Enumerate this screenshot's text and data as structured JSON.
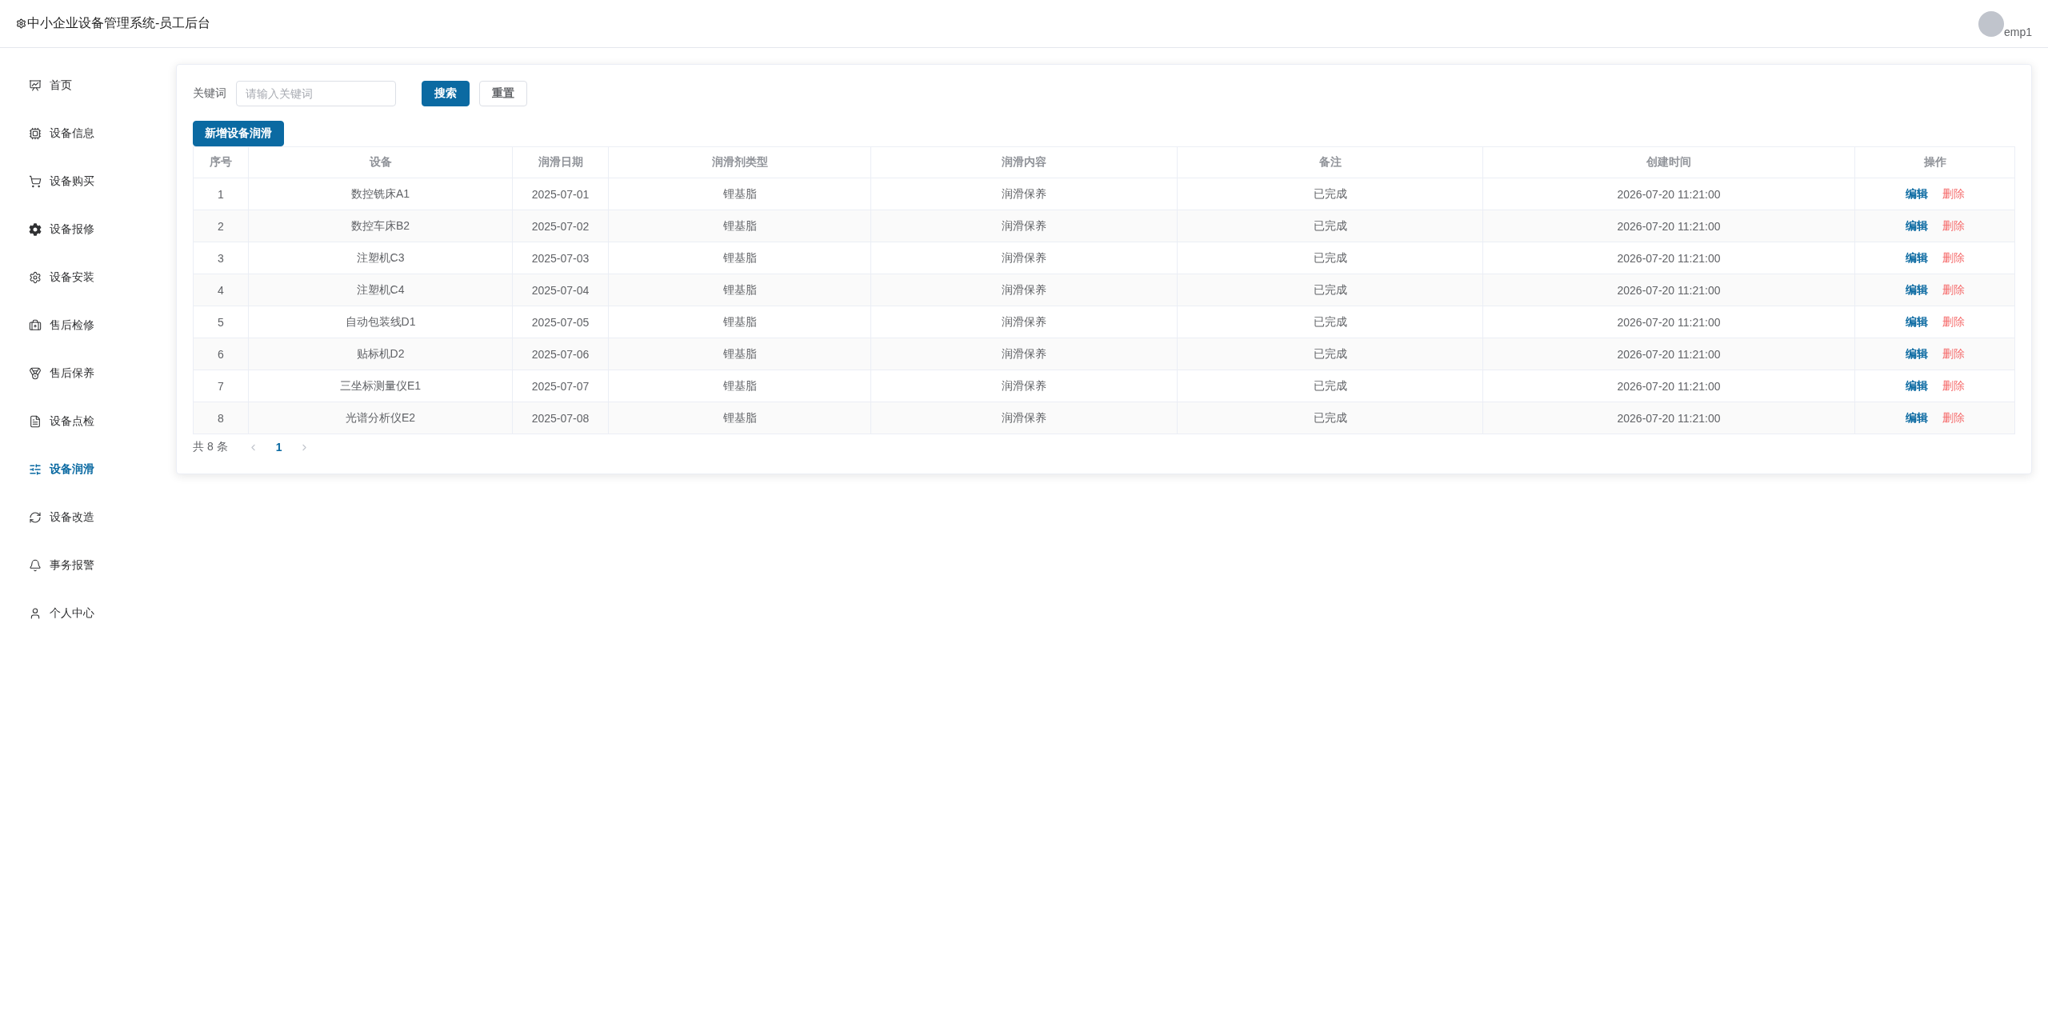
{
  "header": {
    "title": "中小企业设备管理系统-员工后台",
    "user": "emp1"
  },
  "sidebar": {
    "items": [
      {
        "label": "首页",
        "selected": false
      },
      {
        "label": "设备信息",
        "selected": false
      },
      {
        "label": "设备购买",
        "selected": false
      },
      {
        "label": "设备报修",
        "selected": false
      },
      {
        "label": "设备安装",
        "selected": false
      },
      {
        "label": "售后检修",
        "selected": false
      },
      {
        "label": "售后保养",
        "selected": false
      },
      {
        "label": "设备点检",
        "selected": false
      },
      {
        "label": "设备润滑",
        "selected": true
      },
      {
        "label": "设备改造",
        "selected": false
      },
      {
        "label": "事务报警",
        "selected": false
      },
      {
        "label": "个人中心",
        "selected": false
      }
    ]
  },
  "search": {
    "label": "关键词",
    "placeholder": "请输入关键词",
    "buttons": [
      {
        "label": "搜索",
        "kind": "primary"
      },
      {
        "label": "重置",
        "kind": "default"
      }
    ]
  },
  "add_button": "新增设备润滑",
  "table": {
    "columns": [
      "序号",
      "设备",
      "润滑日期",
      "润滑剂类型",
      "润滑内容",
      "备注",
      "创建时间",
      "操作"
    ],
    "rows": [
      {
        "cells": [
          "1",
          "数控铣床A1",
          "2025-07-01",
          "锂基脂",
          "润滑保养",
          "已完成",
          "2026-07-20 11:21:00"
        ],
        "actions": [
          {
            "label": "编辑",
            "kind": "edit"
          },
          {
            "label": "删除",
            "kind": "delete"
          }
        ]
      },
      {
        "cells": [
          "2",
          "数控车床B2",
          "2025-07-02",
          "锂基脂",
          "润滑保养",
          "已完成",
          "2026-07-20 11:21:00"
        ],
        "actions": [
          {
            "label": "编辑",
            "kind": "edit"
          },
          {
            "label": "删除",
            "kind": "delete"
          }
        ]
      },
      {
        "cells": [
          "3",
          "注塑机C3",
          "2025-07-03",
          "锂基脂",
          "润滑保养",
          "已完成",
          "2026-07-20 11:21:00"
        ],
        "actions": [
          {
            "label": "编辑",
            "kind": "edit"
          },
          {
            "label": "删除",
            "kind": "delete"
          }
        ]
      },
      {
        "cells": [
          "4",
          "注塑机C4",
          "2025-07-04",
          "锂基脂",
          "润滑保养",
          "已完成",
          "2026-07-20 11:21:00"
        ],
        "actions": [
          {
            "label": "编辑",
            "kind": "edit"
          },
          {
            "label": "删除",
            "kind": "delete"
          }
        ]
      },
      {
        "cells": [
          "5",
          "自动包装线D1",
          "2025-07-05",
          "锂基脂",
          "润滑保养",
          "已完成",
          "2026-07-20 11:21:00"
        ],
        "actions": [
          {
            "label": "编辑",
            "kind": "edit"
          },
          {
            "label": "删除",
            "kind": "delete"
          }
        ]
      },
      {
        "cells": [
          "6",
          "贴标机D2",
          "2025-07-06",
          "锂基脂",
          "润滑保养",
          "已完成",
          "2026-07-20 11:21:00"
        ],
        "actions": [
          {
            "label": "编辑",
            "kind": "edit"
          },
          {
            "label": "删除",
            "kind": "delete"
          }
        ]
      },
      {
        "cells": [
          "7",
          "三坐标测量仪E1",
          "2025-07-07",
          "锂基脂",
          "润滑保养",
          "已完成",
          "2026-07-20 11:21:00"
        ],
        "actions": [
          {
            "label": "编辑",
            "kind": "edit"
          },
          {
            "label": "删除",
            "kind": "delete"
          }
        ]
      },
      {
        "cells": [
          "8",
          "光谱分析仪E2",
          "2025-07-08",
          "锂基脂",
          "润滑保养",
          "已完成",
          "2026-07-20 11:21:00"
        ],
        "actions": [
          {
            "label": "编辑",
            "kind": "edit"
          },
          {
            "label": "删除",
            "kind": "delete"
          }
        ]
      }
    ]
  },
  "pagination": {
    "total": "共 8 条",
    "prev": {
      "disabled": true
    },
    "pages": [
      {
        "label": "1",
        "selected": true
      }
    ],
    "next": {
      "disabled": true
    }
  }
}
